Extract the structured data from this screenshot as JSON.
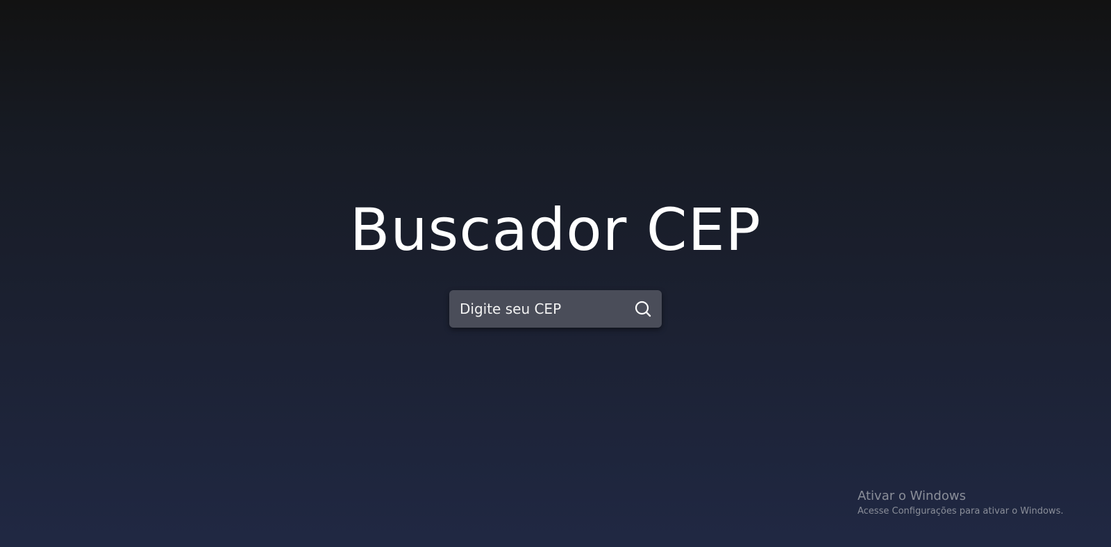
{
  "app": {
    "title": "Buscador CEP"
  },
  "search": {
    "placeholder": "Digite seu CEP",
    "value": "",
    "button_icon": "search-icon"
  },
  "watermark": {
    "title": "Ativar o Windows",
    "subtitle": "Acesse Configurações para ativar o Windows."
  },
  "colors": {
    "background_top": "#121212",
    "background_bottom": "#202843",
    "search_box": "#4a4d59",
    "title_text": "#ffffff",
    "watermark_text": "#8a8e99"
  }
}
